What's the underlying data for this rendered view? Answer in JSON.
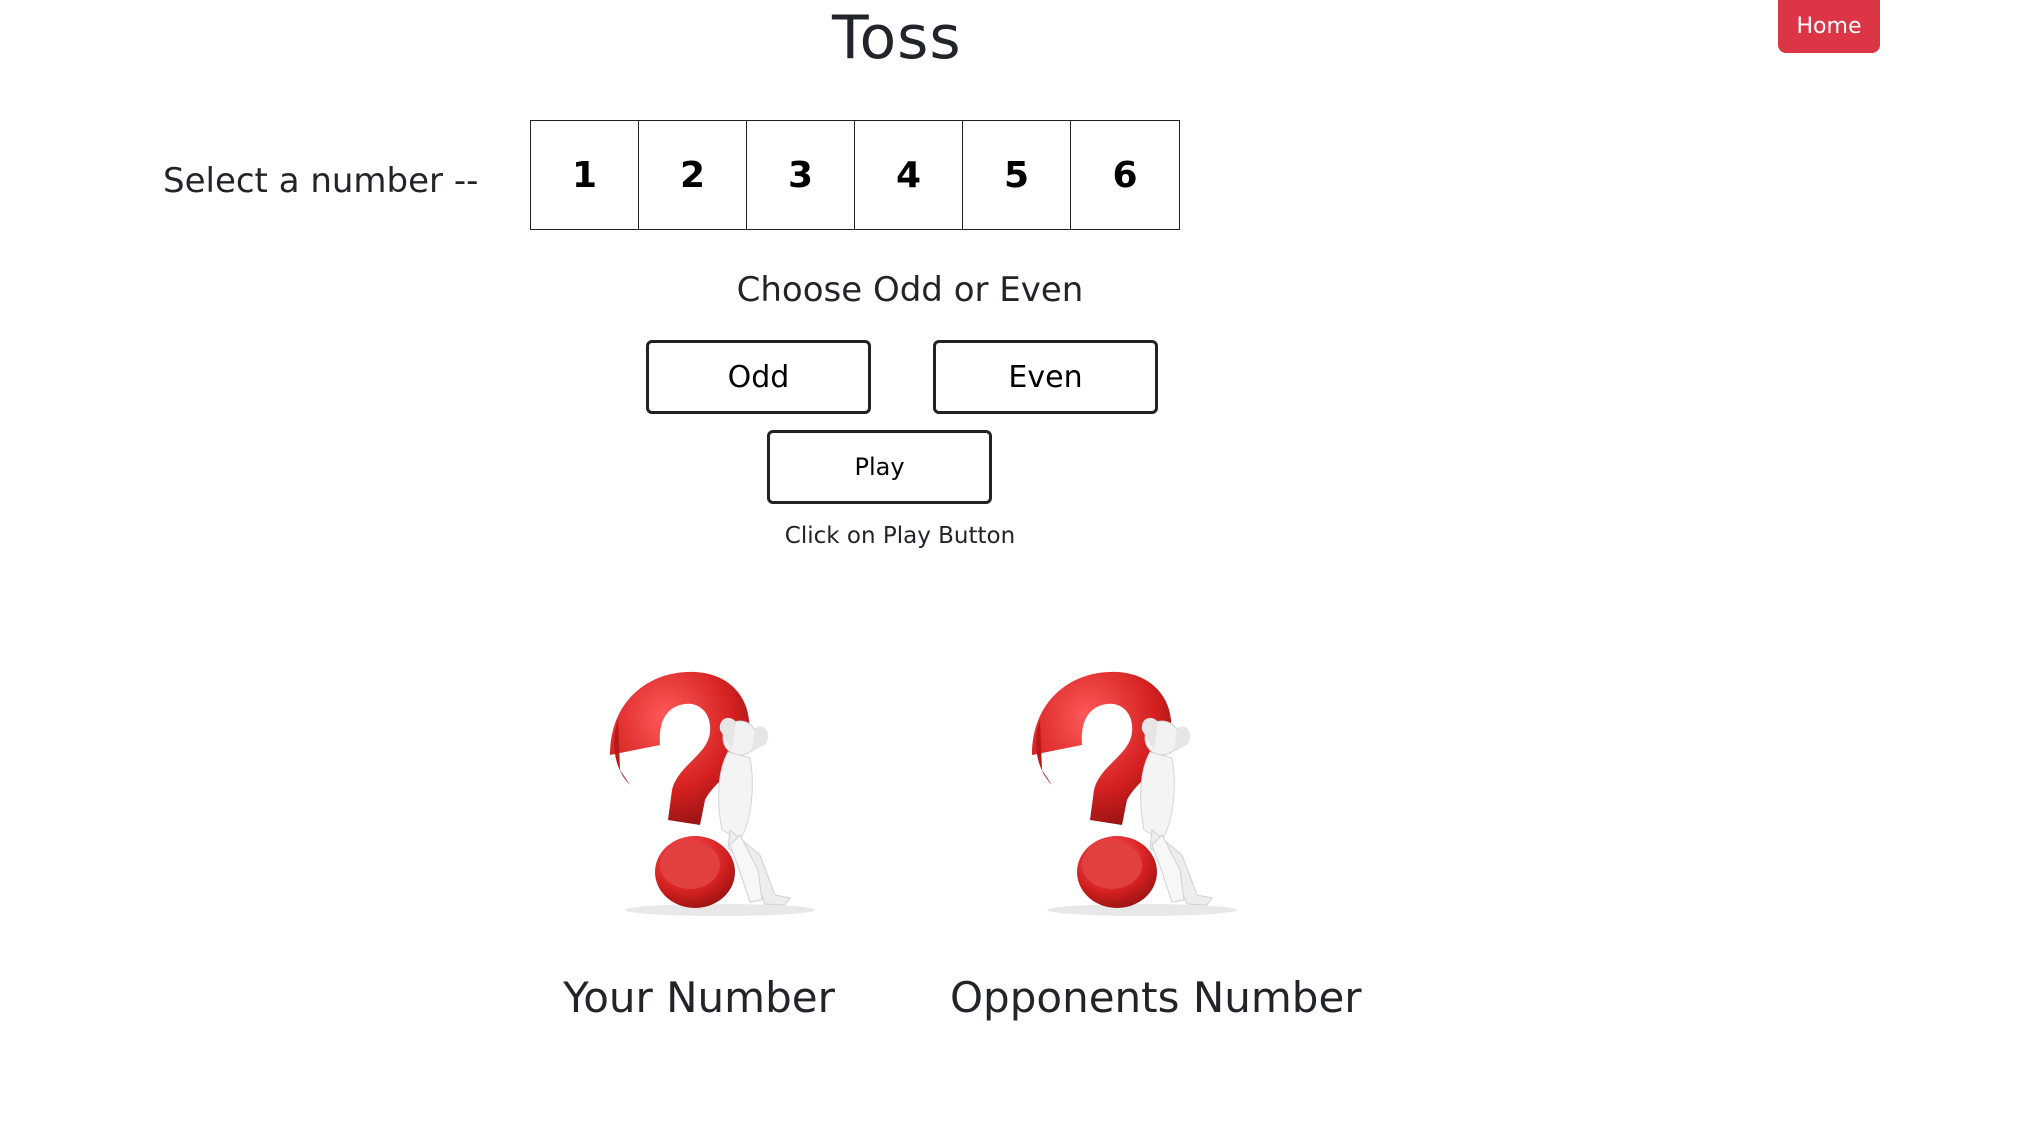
{
  "page": {
    "title": "Toss"
  },
  "nav": {
    "home_label": "Home"
  },
  "number_select": {
    "label": "Select a number --",
    "options": [
      "1",
      "2",
      "3",
      "4",
      "5",
      "6"
    ]
  },
  "parity": {
    "heading": "Choose Odd or Even",
    "odd_label": "Odd",
    "even_label": "Even"
  },
  "play": {
    "button_label": "Play",
    "hint": "Click on Play Button"
  },
  "results": {
    "your_label": "Your Number",
    "opponent_label": "Opponents Number",
    "image_icon": "question-mark-figure-icon"
  },
  "colors": {
    "home_button": "#dc3545",
    "question_mark": "#d42020",
    "text": "#212529"
  }
}
